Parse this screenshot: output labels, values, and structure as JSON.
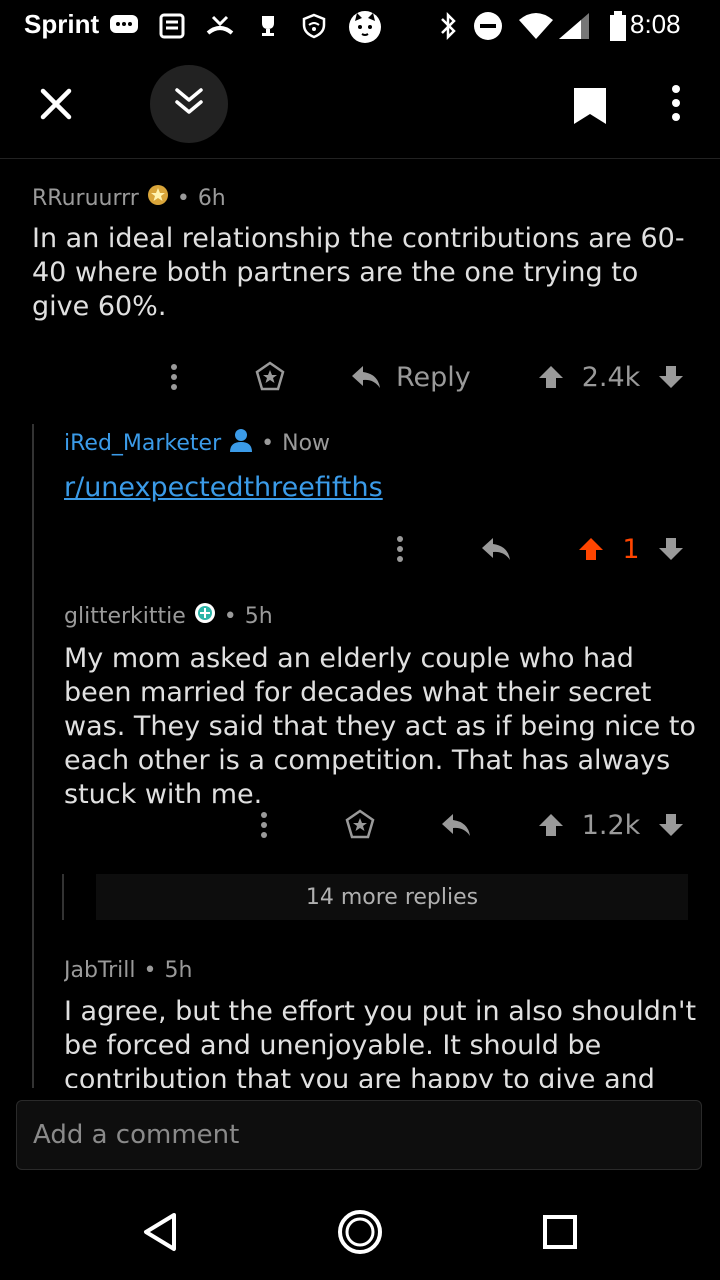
{
  "status_bar": {
    "carrier": "Sprint",
    "time": "8:08"
  },
  "comments": [
    {
      "author": "RRuruurrr",
      "age": "6h",
      "body": "In an ideal relationship the contributions are 60-40 where both partners are the one trying to give 60%.",
      "reply_label": "Reply",
      "score": "2.4k"
    },
    {
      "author": "iRed_Marketer",
      "age": "Now",
      "link_text": "r/unexpectedthreefifths",
      "score": "1"
    },
    {
      "author": "glitterkittie",
      "age": "5h",
      "body": "My mom asked an elderly couple who had been married for decades what their secret was.  They said that they act as if being nice to each other is a competition.  That has always stuck with me.",
      "score": "1.2k"
    },
    {
      "author": "JabTrill",
      "age": "5h",
      "body": "I agree, but the effort you put in also shouldn't be forced and unenjoyable. It should be contribution that you are happy to give and"
    }
  ],
  "more_replies": "14 more replies",
  "comment_box": {
    "placeholder": "Add a comment"
  },
  "colors": {
    "accent": "#3b9be8",
    "upvote": "#ff4500"
  }
}
